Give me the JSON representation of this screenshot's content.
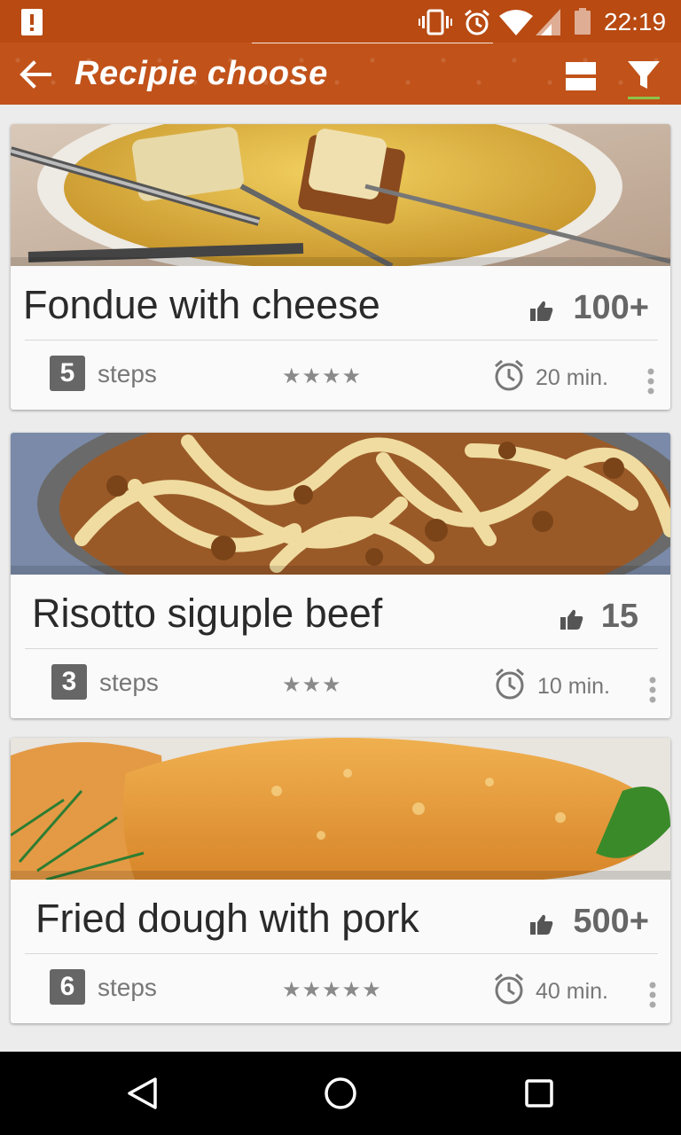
{
  "status": {
    "time": "22:19"
  },
  "app_bar": {
    "title": "Recipie choose"
  },
  "recipes": [
    {
      "title": "Fondue with cheese",
      "likes": "100+",
      "steps_count": "5",
      "steps_label": "steps",
      "stars": "★★★★",
      "time": "20 min.",
      "image": "cheese-fondue-photo"
    },
    {
      "title": "Risotto siguple beef",
      "likes": "15",
      "steps_count": "3",
      "steps_label": "steps",
      "stars": "★★★",
      "time": "10 min.",
      "image": "pasta-with-beef-photo"
    },
    {
      "title": "Fried dough with pork",
      "likes": "500+",
      "steps_count": "6",
      "steps_label": "steps",
      "stars": "★★★★★",
      "time": "40 min.",
      "image": "fried-dough-photo"
    }
  ],
  "colors": {
    "app_bar": "#c1521a",
    "status_bar": "#b84a12",
    "filter_underline": "#8bc34a"
  }
}
